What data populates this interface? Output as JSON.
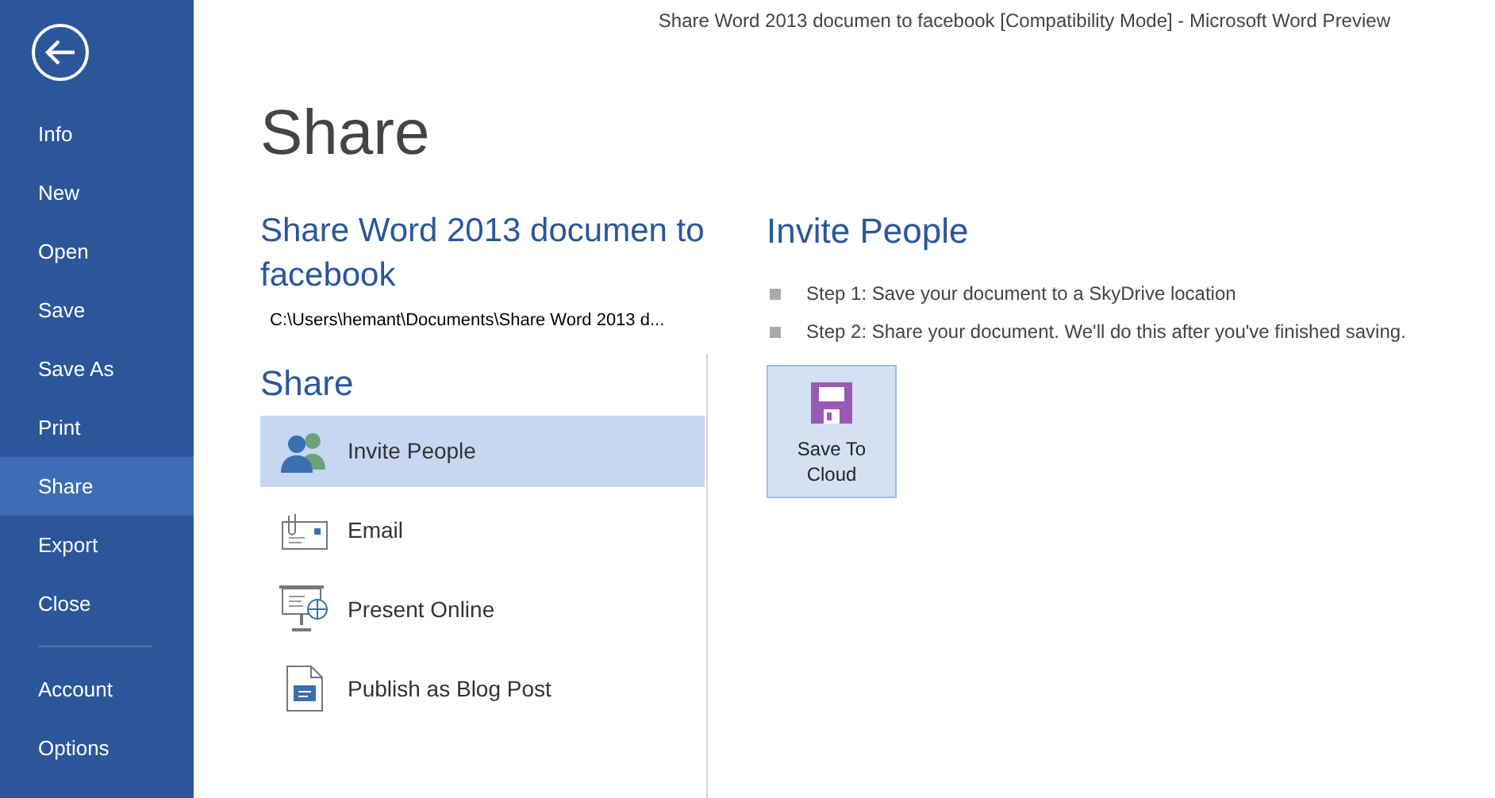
{
  "window": {
    "title": "Share Word 2013 documen to facebook [Compatibility Mode] - Microsoft Word Preview"
  },
  "sidebar": {
    "items": [
      {
        "label": "Info",
        "selected": false
      },
      {
        "label": "New",
        "selected": false
      },
      {
        "label": "Open",
        "selected": false
      },
      {
        "label": "Save",
        "selected": false
      },
      {
        "label": "Save As",
        "selected": false
      },
      {
        "label": "Print",
        "selected": false
      },
      {
        "label": "Share",
        "selected": true
      },
      {
        "label": "Export",
        "selected": false
      },
      {
        "label": "Close",
        "selected": false
      },
      {
        "label": "Account",
        "selected": false,
        "divider_before": true
      },
      {
        "label": "Options",
        "selected": false
      }
    ]
  },
  "page_title": "Share",
  "document": {
    "title": "Share Word 2013 documen to facebook",
    "path": "C:\\Users\\hemant\\Documents\\Share Word 2013 d..."
  },
  "share": {
    "heading": "Share",
    "items": [
      {
        "label": "Invite People",
        "kind": "people",
        "selected": true
      },
      {
        "label": "Email",
        "kind": "email",
        "selected": false
      },
      {
        "label": "Present Online",
        "kind": "present",
        "selected": false
      },
      {
        "label": "Publish as Blog Post",
        "kind": "blog",
        "selected": false
      }
    ]
  },
  "detail": {
    "heading": "Invite People",
    "steps": [
      "Step 1: Save your document to a SkyDrive location",
      "Step 2: Share your document. We'll do this after you've finished saving."
    ],
    "button": "Save To Cloud"
  }
}
